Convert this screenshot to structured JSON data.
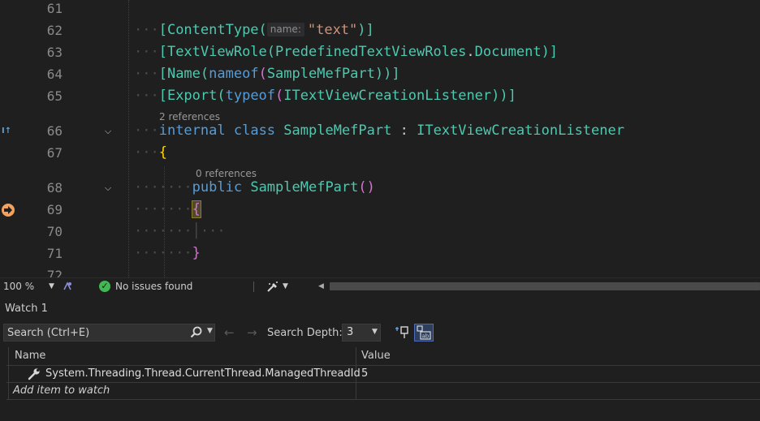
{
  "editor": {
    "lines": [
      {
        "n": "61"
      },
      {
        "n": "62"
      },
      {
        "n": "63"
      },
      {
        "n": "64"
      },
      {
        "n": "65"
      },
      {
        "n": "66"
      },
      {
        "n": "67"
      },
      {
        "n": "68"
      },
      {
        "n": "69"
      },
      {
        "n": "70"
      },
      {
        "n": "71"
      },
      {
        "n": "72"
      }
    ],
    "tokens": {
      "content_type_attr": "[ContentType(",
      "param_hint": "name:",
      "text_literal": "\"text\"",
      "close_paren_bracket": ")]",
      "text_view_role": "[TextViewRole(",
      "predefined": "PredefinedTextViewRoles",
      "dot": ".",
      "document": "Document",
      "name_attr": "[Name(",
      "nameof": "nameof",
      "sample_mef_part": "SampleMefPart",
      "close_double": "))]",
      "export_attr": "[Export(",
      "typeof": "typeof",
      "listener": "ITextViewCreationListener",
      "internal": "internal",
      "class_kw": "class",
      "colon": ":",
      "open_brace": "{",
      "close_brace": "}",
      "public_kw": "public",
      "ctor_parens": "()",
      "open_paren": "(",
      "close_paren": ")"
    },
    "codelens": {
      "class_refs": "2 references",
      "ctor_refs": "0 references"
    },
    "fold_glyph": "⌵"
  },
  "status": {
    "zoom": "100 %",
    "issues": "No issues found"
  },
  "watch": {
    "title": "Watch 1",
    "search_placeholder": "Search (Ctrl+E)",
    "search_depth_label": "Search Depth:",
    "search_depth_value": "3",
    "columns": {
      "name": "Name",
      "value": "Value"
    },
    "rows": [
      {
        "name": "System.Threading.Thread.CurrentThread.ManagedThreadId",
        "value": "5"
      }
    ],
    "add_item_placeholder": "Add item to watch"
  },
  "colors": {
    "background": "#1f1f1f",
    "keyword": "#569cd6",
    "type": "#4ec9b0",
    "method": "#dcdcaa",
    "string": "#ce9178",
    "bracket_outer": "#da70d6",
    "bracket_inner": "#ffd700",
    "breakpoint_arrow": "#f2a25a"
  },
  "icons": {
    "bookmark": "bookmark-icon",
    "execution_pointer": "current-statement-arrow-icon",
    "issues": "check-circle-icon",
    "search": "search-icon",
    "wrench": "wrench-icon",
    "pin": "pin-icon",
    "hex": "hexadecimal-display-icon"
  }
}
